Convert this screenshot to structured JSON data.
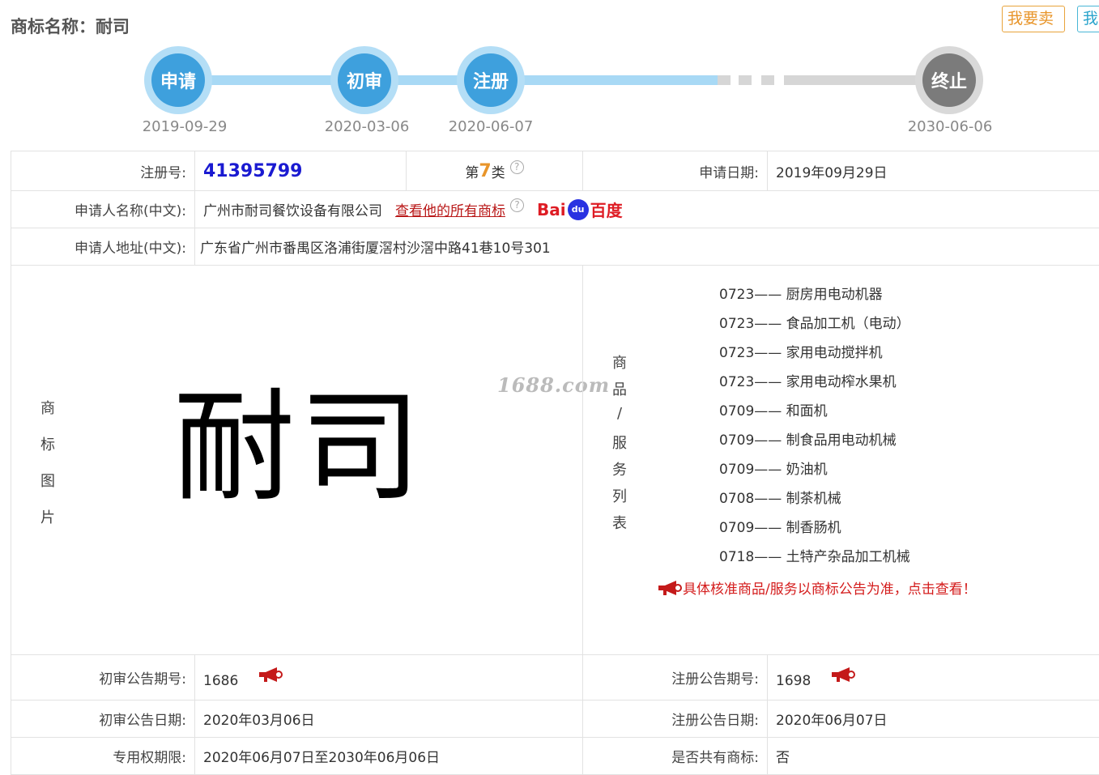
{
  "header": {
    "title": "商标名称：耐司",
    "sell_button": "我要卖",
    "other_button": "我"
  },
  "timeline": [
    {
      "label": "申请",
      "date": "2019-09-29"
    },
    {
      "label": "初审",
      "date": "2020-03-06"
    },
    {
      "label": "注册",
      "date": "2020-06-07"
    },
    {
      "label": "终止",
      "date": "2030-06-06"
    }
  ],
  "info": {
    "reg_no_label": "注册号:",
    "reg_no": "41395799",
    "class_prefix": "第",
    "class_num": "7",
    "class_suffix": "类",
    "apply_date_label": "申请日期:",
    "apply_date": "2019年09月29日",
    "applicant_label": "申请人名称(中文):",
    "applicant": "广州市耐司餐饮设备有限公司",
    "all_marks_link": "查看他的所有商标",
    "baidu_left": "Bai",
    "baidu_paw": "du",
    "baidu_right": "百度",
    "address_label": "申请人地址(中文):",
    "address": "广东省广州市番禺区洛浦街厦滘村沙滘中路41巷10号301"
  },
  "mark": {
    "section_label": [
      "商",
      "标",
      "图",
      "片"
    ],
    "text": "耐司",
    "watermark": "1688.com"
  },
  "goods": {
    "section_label": [
      "商",
      "品",
      "/",
      "服",
      "务",
      "列",
      "表"
    ],
    "items": [
      {
        "code": "0723——",
        "name": "厨房用电动机器"
      },
      {
        "code": "0723——",
        "name": "食品加工机（电动）"
      },
      {
        "code": "0723——",
        "name": "家用电动搅拌机"
      },
      {
        "code": "0723——",
        "name": "家用电动榨水果机"
      },
      {
        "code": "0709——",
        "name": "和面机"
      },
      {
        "code": "0709——",
        "name": "制食品用电动机械"
      },
      {
        "code": "0709——",
        "name": "奶油机"
      },
      {
        "code": "0708——",
        "name": "制茶机械"
      },
      {
        "code": "0709——",
        "name": "制香肠机"
      },
      {
        "code": "0718——",
        "name": "土特产杂品加工机械"
      }
    ],
    "notice": "具体核准商品/服务以商标公告为准，点击查看！"
  },
  "bulletin": {
    "prelim_no_label": "初审公告期号:",
    "prelim_no": "1686",
    "reg_no_label": "注册公告期号:",
    "reg_no": "1698",
    "prelim_date_label": "初审公告日期:",
    "prelim_date": "2020年03月06日",
    "reg_date_label": "注册公告日期:",
    "reg_date": "2020年06月07日",
    "term_label": "专用权期限:",
    "term": "2020年06月07日至2030年06月06日",
    "shared_label": "是否共有商标:",
    "shared": "否"
  },
  "colors": {
    "timeline_active": "#3ea0dd",
    "timeline_end": "#7b7b7b",
    "reg_no": "#1a1ad1",
    "class_num": "#e8952a",
    "notice": "#d41c1c"
  }
}
